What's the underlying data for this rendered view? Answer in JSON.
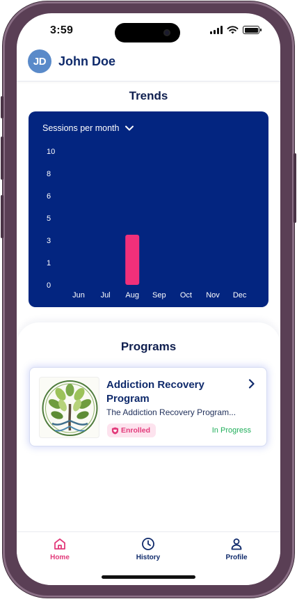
{
  "status_bar": {
    "time": "3:59"
  },
  "header": {
    "avatar_initials": "JD",
    "user_name": "John Doe"
  },
  "trends": {
    "title": "Trends",
    "dropdown_label": "Sessions per month",
    "icon": "chevron-down-icon"
  },
  "chart_data": {
    "type": "bar",
    "categories": [
      "Jun",
      "Jul",
      "Aug",
      "Sep",
      "Oct",
      "Nov",
      "Dec"
    ],
    "values": [
      0,
      0,
      3.5,
      0,
      0,
      0,
      0
    ],
    "y_ticks": [
      "0",
      "1",
      "3",
      "5",
      "6",
      "8",
      "10"
    ],
    "ylim": [
      0,
      10
    ],
    "grid": false,
    "bar_color": "#f0307a",
    "background": "#032580"
  },
  "programs": {
    "title": "Programs",
    "items": [
      {
        "title": "Addiction Recovery Program",
        "description": "The Addiction Recovery Program...",
        "badge": "Enrolled",
        "status": "In Progress",
        "thumbnail_icon": "tree-of-life-icon"
      }
    ]
  },
  "nav": {
    "items": [
      {
        "label": "Home",
        "icon": "home-icon",
        "active": true
      },
      {
        "label": "History",
        "icon": "clock-icon",
        "active": false
      },
      {
        "label": "Profile",
        "icon": "user-icon",
        "active": false
      }
    ]
  },
  "colors": {
    "primary": "#032580",
    "accent": "#e23a7a",
    "success": "#1fae5a",
    "heading": "#0f2a6b"
  }
}
